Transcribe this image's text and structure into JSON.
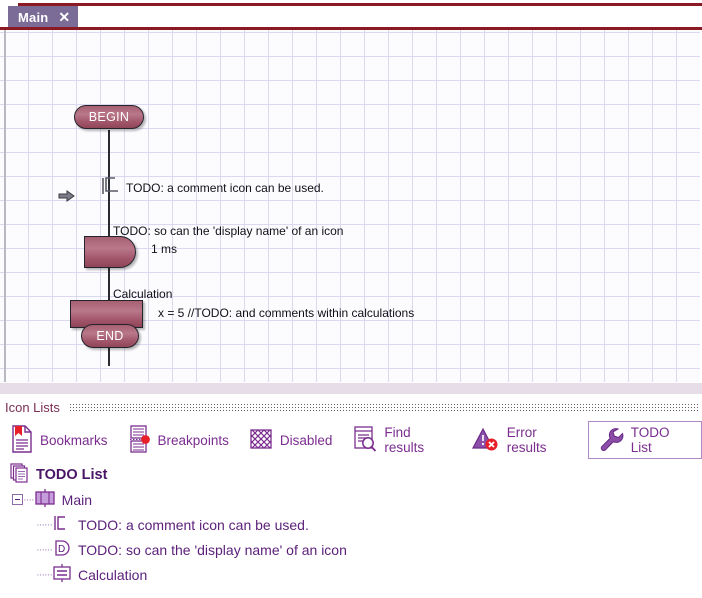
{
  "window": {
    "tab": {
      "label": "Main",
      "close_icon": "close-icon",
      "close_glyph": "✕"
    }
  },
  "canvas": {
    "nodes": [
      {
        "id": "begin",
        "type": "terminal",
        "label": "BEGIN"
      },
      {
        "id": "delay",
        "type": "delay",
        "label": "",
        "display_name": "TODO: so can the 'display name' of an icon",
        "value": "1 ms"
      },
      {
        "id": "calculation",
        "type": "calc",
        "label": "",
        "display_name": "Calculation",
        "value": "x = 5 //TODO: and comments within calculations"
      },
      {
        "id": "end",
        "type": "terminal",
        "label": "END"
      }
    ],
    "comment": {
      "text": "TODO: a comment icon can be used.",
      "icon": "comment-bracket-icon"
    },
    "cursor_marker": "arrow-right-marker",
    "colors": {
      "node_fill": "#b0697c",
      "node_border": "#24242c",
      "grid_line": "#dcd8ef",
      "accent_red": "#8b1a24",
      "tab_bg": "#7b6c97"
    }
  },
  "panel": {
    "title": "Icon Lists",
    "tabs": [
      {
        "id": "bookmarks",
        "label": "Bookmarks",
        "icon": "bookmark-document-icon",
        "selected": false
      },
      {
        "id": "breakpoints",
        "label": "Breakpoints",
        "icon": "breakpoint-document-icon",
        "selected": false
      },
      {
        "id": "disabled",
        "label": "Disabled",
        "icon": "crosshatch-disabled-icon",
        "selected": false
      },
      {
        "id": "find-results",
        "label": "Find results",
        "icon": "document-magnifier-icon",
        "selected": false
      },
      {
        "id": "error-results",
        "label": "Error results",
        "icon": "warning-triangle-error-icon",
        "selected": false
      },
      {
        "id": "todo-list",
        "label": "TODO List",
        "icon": "wrench-icon",
        "selected": true
      }
    ],
    "accent": "#7b2d8f"
  },
  "tree": {
    "rows": [
      {
        "id": "root",
        "depth": 0,
        "label": "TODO List",
        "icon": "stacked-pages-icon",
        "expander": "none"
      },
      {
        "id": "main",
        "depth": 1,
        "label": "Main",
        "icon": "flowchart-block-icon",
        "expander": "minus"
      },
      {
        "id": "comment",
        "depth": 2,
        "label": "TODO: a comment icon can be used.",
        "icon": "comment-bracket-icon",
        "expander": "none"
      },
      {
        "id": "delay",
        "depth": 2,
        "label": "TODO: so can the 'display name' of an icon",
        "icon": "delay-d-icon",
        "expander": "none"
      },
      {
        "id": "calculation",
        "depth": 2,
        "label": "Calculation",
        "icon": "calculation-icon",
        "expander": "none"
      }
    ]
  }
}
